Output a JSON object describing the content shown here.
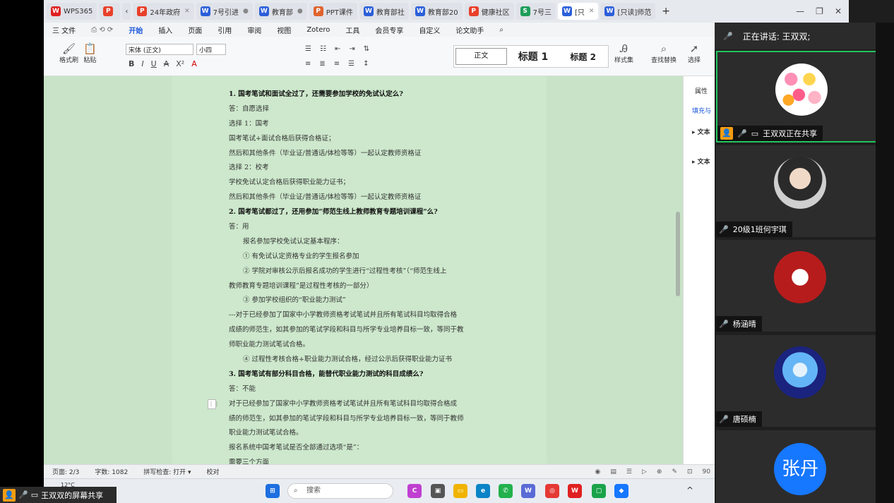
{
  "tabs": [
    {
      "label": "WPS365",
      "icon": "W",
      "color": "#e02020",
      "active": false
    },
    {
      "label": "",
      "icon": "P",
      "color": "#e8402a",
      "active": false
    },
    {
      "label": "24年政府",
      "icon": "P",
      "color": "#e8402a",
      "active": false
    },
    {
      "label": "7号引进",
      "icon": "W",
      "color": "#2b5fd9",
      "active": false
    },
    {
      "label": "教育部",
      "icon": "W",
      "color": "#2b5fd9",
      "active": false
    },
    {
      "label": "PPT课件",
      "icon": "P",
      "color": "#e0632c",
      "active": false
    },
    {
      "label": "教育部社",
      "icon": "W",
      "color": "#2b5fd9",
      "active": false
    },
    {
      "label": "教育部20",
      "icon": "W",
      "color": "#2b5fd9",
      "active": false
    },
    {
      "label": "健康社区",
      "icon": "P",
      "color": "#e8402a",
      "active": false
    },
    {
      "label": "7号三",
      "icon": "S",
      "color": "#1e9e5a",
      "active": false
    },
    {
      "label": "[只",
      "icon": "W",
      "color": "#2b5fd9",
      "active": true
    },
    {
      "label": "[只读]师范",
      "icon": "W",
      "color": "#2b5fd9",
      "active": false
    }
  ],
  "menu": {
    "file": "三 文件",
    "items": [
      "开始",
      "插入",
      "页面",
      "引用",
      "审阅",
      "视图",
      "Zotero",
      "工具",
      "会员专享",
      "自定义",
      "论文助手"
    ],
    "active": "开始"
  },
  "ribbon": {
    "format_painter": "格式刷",
    "paste": "粘贴",
    "font_name": "宋体 (正文)",
    "font_size": "小四",
    "styles": {
      "normal": "正文",
      "h1": "标题 1",
      "h2": "标题 2"
    },
    "style_set": "样式集",
    "find_replace": "查找替换",
    "select": "选择"
  },
  "document": {
    "lines": [
      {
        "text": "1.   国考笔试和面试全过了，还需要参加学校的免试认定么?",
        "style": "b"
      },
      {
        "text": "答：自愿选择",
        "style": ""
      },
      {
        "text": "选择 1：国考",
        "style": ""
      },
      {
        "text": "国考笔试+面试合格后获得合格证；",
        "style": ""
      },
      {
        "text": "然后和其他条件（毕业证/普通话/体检等等）一起认定教师资格证",
        "style": ""
      },
      {
        "text": "选择 2：校考",
        "style": ""
      },
      {
        "text": "学校免试认定合格后获得职业能力证书；",
        "style": ""
      },
      {
        "text": "然后和其他条件（毕业证/普通话/体检等等）一起认定教师资格证",
        "style": ""
      },
      {
        "text": "2.   国考笔试都过了，还用参加“师范生线上教师教育专题培训课程”么?",
        "style": "b"
      },
      {
        "text": "答：用",
        "style": ""
      },
      {
        "text": "报名参加学校免试认定基本程序：",
        "style": "i1"
      },
      {
        "text": "①   有免试认定资格专业的学生报名参加",
        "style": "i1"
      },
      {
        "text": "②   学院对审核公示后报名成功的学生进行“过程性考核”（“师范生线上",
        "style": "i1"
      },
      {
        "text": "教师教育专题培训课程”是过程性考核的一部分）",
        "style": ""
      },
      {
        "text": "③   参加学校组织的“职业能力测试”",
        "style": "i1"
      },
      {
        "text": "---对于已经参加了国家中小学教师资格考试笔试并且所有笔试科目均取得合格",
        "style": ""
      },
      {
        "text": "成绩的师范生，如其参加的笔试学段和科目与所学专业培养目标一致，等同于教",
        "style": ""
      },
      {
        "text": "师职业能力测试笔试合格。",
        "style": ""
      },
      {
        "text": "④   过程性考核合格+职业能力测试合格，经过公示后获得职业能力证书",
        "style": "i1"
      },
      {
        "text": "3.   国考笔试有部分科目合格，能替代职业能力测试的科目成绩么?",
        "style": "b"
      },
      {
        "text": "答：不能",
        "style": ""
      },
      {
        "text": "对于已经参加了国家中小学教师资格考试笔试并且所有笔试科目均取得合格成",
        "style": ""
      },
      {
        "text": "绩的师范生，如其参加的笔试学段和科目与所学专业培养目标一致，等同于教师",
        "style": ""
      },
      {
        "text": "职业能力测试笔试合格。",
        "style": ""
      },
      {
        "text": "报名系统中国考笔试是否全部通过选项“是”：",
        "style": ""
      },
      {
        "text": "需要三个方面",
        "style": ""
      }
    ]
  },
  "right_pane": {
    "title": "属性",
    "item1": "填充与",
    "item2": "▸ 文本",
    "item3": "▸ 文本"
  },
  "status": {
    "page": "页面: 2/3",
    "words": "字数: 1082",
    "spell": "拼写检查: 打开 ▾",
    "proof": "校对",
    "zoom": "90"
  },
  "taskbar": {
    "search": "搜索",
    "weather": "12°C"
  },
  "share_label": "王双双的屏幕共享",
  "meeting": {
    "speaking": "正在讲话:  王双双;",
    "participants": [
      {
        "name": "王双双正在共享",
        "mic": "on",
        "type": "flowers",
        "active": true
      },
      {
        "name": "20级1班何宇琪",
        "mic": "off",
        "type": "girl",
        "active": false
      },
      {
        "name": "杨涵晴",
        "mic": "off",
        "type": "red",
        "active": false
      },
      {
        "name": "唐硕楠",
        "mic": "off",
        "type": "blue",
        "active": false
      },
      {
        "name": "张丹",
        "mic": "off",
        "type": "text",
        "active": false
      }
    ],
    "zhangdan_avatar": "张丹"
  }
}
